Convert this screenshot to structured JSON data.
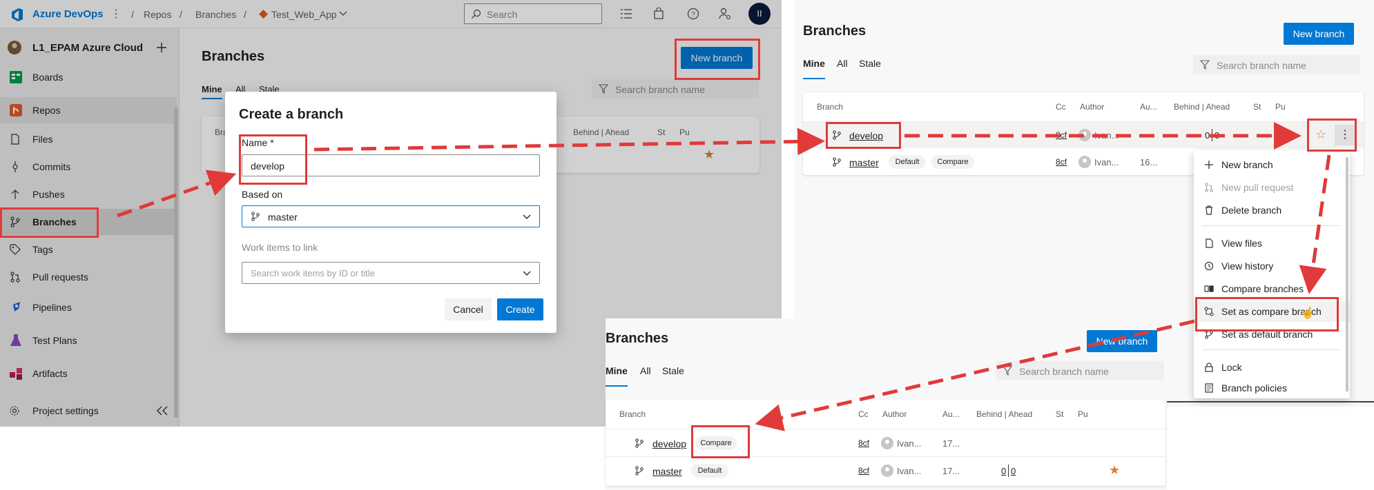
{
  "colors": {
    "accent": "#0078d4",
    "annotation_red": "#e03a3a",
    "star": "#d67f3c"
  },
  "topbar": {
    "brand": "Azure DevOps",
    "breadcrumb": [
      "Repos",
      "Branches",
      "Test_Web_App"
    ],
    "search_placeholder": "Search",
    "avatar_initials": "II",
    "icons": [
      "list-icon",
      "shopping-bag-icon",
      "help-icon",
      "user-settings-icon"
    ]
  },
  "sidebar": {
    "project": "L1_EPAM Azure Cloud",
    "items": [
      {
        "label": "Boards",
        "icon": "boards-icon"
      },
      {
        "label": "Repos",
        "icon": "repos-icon"
      },
      {
        "label": "Files",
        "icon": "files-icon"
      },
      {
        "label": "Commits",
        "icon": "commits-icon"
      },
      {
        "label": "Pushes",
        "icon": "pushes-icon"
      },
      {
        "label": "Branches",
        "icon": "branch-icon"
      },
      {
        "label": "Tags",
        "icon": "tag-icon"
      },
      {
        "label": "Pull requests",
        "icon": "pull-request-icon"
      },
      {
        "label": "Pipelines",
        "icon": "pipelines-icon"
      },
      {
        "label": "Test Plans",
        "icon": "test-plans-icon"
      },
      {
        "label": "Artifacts",
        "icon": "artifacts-icon"
      }
    ],
    "settings": "Project settings"
  },
  "page": {
    "title": "Branches",
    "new_branch": "New branch",
    "tabs": [
      "Mine",
      "All",
      "Stale"
    ],
    "filter_placeholder": "Search branch name",
    "columns": {
      "branch": "Branch",
      "commit": "Cc",
      "author": "Author",
      "authored": "Au...",
      "behind_ahead": "Behind | Ahead",
      "status": "St",
      "pr": "Pu"
    }
  },
  "dialog": {
    "title": "Create a branch",
    "name_label": "Name *",
    "name_value": "develop",
    "based_on_label": "Based on",
    "based_on_value": "master",
    "work_items_label": "Work items to link",
    "work_items_placeholder": "Search work items by ID or title",
    "cancel": "Cancel",
    "create": "Create"
  },
  "list_b": {
    "rows": [
      {
        "name": "develop",
        "commit": "8cf",
        "author": "Ivan...",
        "date": "",
        "behind": "0",
        "ahead": "0"
      },
      {
        "name": "master",
        "badge_default": "Default",
        "badge_compare": "Compare",
        "commit": "8cf",
        "author": "Ivan...",
        "date": "16..."
      }
    ]
  },
  "menu": {
    "items": [
      {
        "label": "New branch",
        "icon": "plus-icon",
        "disabled": false
      },
      {
        "label": "New pull request",
        "icon": "pull-request-icon",
        "disabled": true
      },
      {
        "label": "Delete branch",
        "icon": "trash-icon",
        "disabled": false
      },
      {
        "label": "View files",
        "icon": "file-icon",
        "disabled": false
      },
      {
        "label": "View history",
        "icon": "history-icon",
        "disabled": false
      },
      {
        "label": "Compare branches",
        "icon": "compare-icon",
        "disabled": false
      },
      {
        "label": "Set as compare branch",
        "icon": "set-compare-icon",
        "disabled": false
      },
      {
        "label": "Set as default branch",
        "icon": "branch-icon",
        "disabled": false
      },
      {
        "label": "Lock",
        "icon": "lock-icon",
        "disabled": false
      },
      {
        "label": "Branch policies",
        "icon": "policy-icon",
        "disabled": false
      }
    ]
  },
  "list_c": {
    "rows": [
      {
        "name": "develop",
        "badge": "Compare",
        "commit": "8cf",
        "author": "Ivan...",
        "date": "17..."
      },
      {
        "name": "master",
        "badge": "Default",
        "commit": "8cf",
        "author": "Ivan...",
        "date": "17...",
        "behind": "0",
        "ahead": "0"
      }
    ]
  }
}
